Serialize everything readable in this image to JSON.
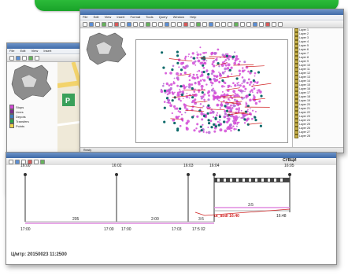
{
  "colors": {
    "banner": "#2ebc3a",
    "magenta": "#d24ad6",
    "teal": "#0f6b6b",
    "accent_red": "#d12424",
    "pink_line": "#e08be0"
  },
  "main_window": {
    "menu": [
      "File",
      "Edit",
      "View",
      "Insert",
      "Format",
      "Tools",
      "Query",
      "Window",
      "Help"
    ],
    "status_left": "Ready"
  },
  "legend": {
    "items": [
      {
        "label": "Stops",
        "color": "#d24ad6"
      },
      {
        "label": "Lines",
        "color": "#7b2f8a"
      },
      {
        "label": "Depots",
        "color": "#3f7fbf"
      },
      {
        "label": "Transfers",
        "color": "#2aa04a"
      },
      {
        "label": "Points",
        "color": "#f0d24a"
      }
    ]
  },
  "right_pane": {
    "rows": [
      "Layer 1",
      "Layer 2",
      "Layer 3",
      "Layer 4",
      "Layer 5",
      "Layer 6",
      "Layer 7",
      "Layer 8",
      "Layer 9",
      "Layer 10",
      "Layer 11",
      "Layer 12",
      "Layer 13",
      "Layer 14",
      "Layer 15",
      "Layer 16",
      "Layer 17",
      "Layer 18",
      "Layer 19",
      "Layer 20",
      "Layer 21",
      "Layer 22",
      "Layer 23",
      "Layer 24",
      "Layer 25",
      "Layer 26",
      "Layer 27",
      "Layer 28"
    ]
  },
  "timeline": {
    "stops": [
      {
        "top": "16:00"
      },
      {
        "top": "16:02"
      },
      {
        "top": "16:03"
      },
      {
        "top": "16:04"
      },
      {
        "top": "16:05"
      }
    ],
    "end_label_title": "СУВЦИ",
    "end_label_time": "16:05",
    "segment_values": [
      "205",
      "2:00",
      "3:5",
      "3:5"
    ],
    "bottom_times": [
      "17:00",
      "17:00",
      "17:00",
      "17:03",
      "17:5 02",
      "16:48"
    ],
    "red_label": "ut_aodl 16:40",
    "footer": "Ц/мтр: 20150023 11:2500"
  }
}
